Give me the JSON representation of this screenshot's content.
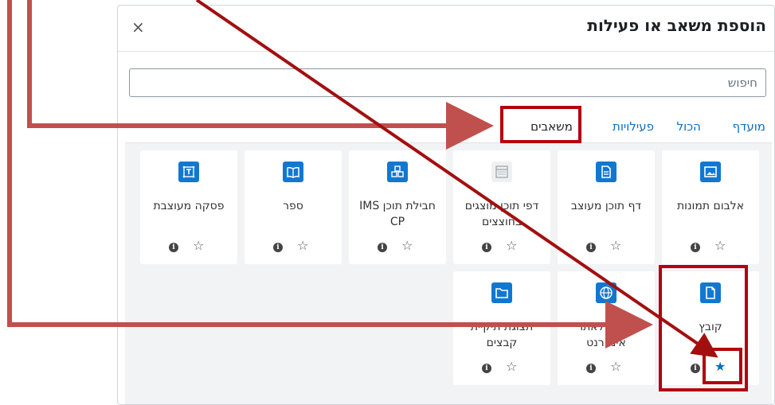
{
  "dialog": {
    "title": "הוספת משאב או פעילות",
    "close_label": "×",
    "search_placeholder": "חיפוש"
  },
  "tabs": [
    {
      "label": "מועדף",
      "active": false
    },
    {
      "label": "הכול",
      "active": false
    },
    {
      "label": "פעילויות",
      "active": false
    },
    {
      "label": "משאבים",
      "active": true
    }
  ],
  "resources": [
    {
      "label": "אלבום תמונות",
      "icon": "image-icon",
      "favorite": false
    },
    {
      "label": "דף תוכן מעוצב",
      "icon": "page-icon",
      "favorite": false
    },
    {
      "label": "דפי תוכן מוצגים בחוצצים",
      "icon": "tabs-page-icon",
      "favorite": false
    },
    {
      "label": "חבילת תוכן IMS CP",
      "icon": "package-icon",
      "favorite": false
    },
    {
      "label": "ספר",
      "icon": "book-icon",
      "favorite": false
    },
    {
      "label": "פסקה מעוצבת",
      "icon": "text-box-icon",
      "favorite": false
    },
    {
      "label": "קובץ",
      "icon": "file-icon",
      "favorite": true
    },
    {
      "label": "קישור לאתר אינטרנט",
      "icon": "globe-icon",
      "favorite": false
    },
    {
      "label": "תצוגת תיקיית קבצים",
      "icon": "folder-icon",
      "favorite": false
    }
  ],
  "glyphs": {
    "info": "i",
    "star_empty": "☆",
    "star_filled": "★"
  },
  "colors": {
    "accent": "#1177d1",
    "link": "#0f6cbf",
    "annotation": "#b3000c",
    "arrow": "#c0504d"
  }
}
